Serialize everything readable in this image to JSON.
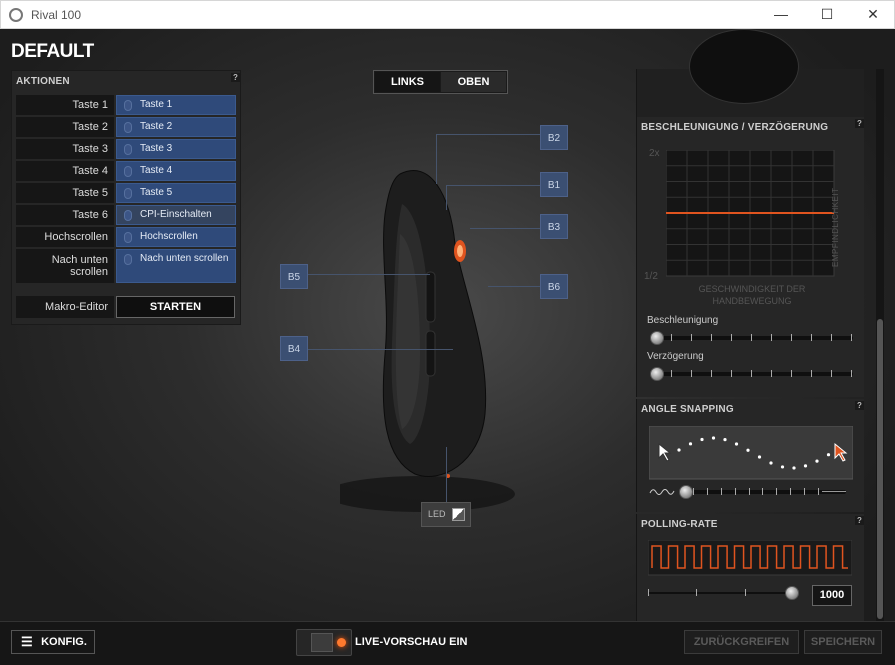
{
  "window": {
    "title": "Rival 100",
    "minimize": "—",
    "maximize": "☐",
    "close": "✕"
  },
  "profile": {
    "name": "DEFAULT"
  },
  "actions": {
    "title": "AKTIONEN",
    "help": "?",
    "rows": [
      {
        "label": "Taste 1",
        "value": "Taste 1"
      },
      {
        "label": "Taste 2",
        "value": "Taste 2"
      },
      {
        "label": "Taste 3",
        "value": "Taste 3"
      },
      {
        "label": "Taste 4",
        "value": "Taste 4"
      },
      {
        "label": "Taste 5",
        "value": "Taste 5"
      },
      {
        "label": "Taste 6",
        "value": "CPI-Einschalten"
      },
      {
        "label": "Hochscrollen",
        "value": "Hochscrollen"
      },
      {
        "label": "Nach unten scrollen",
        "value": "Nach unten scrollen"
      }
    ],
    "macro_label": "Makro-Editor",
    "macro_button": "STARTEN"
  },
  "view_toggle": {
    "left": "LINKS",
    "top": "OBEN",
    "selected": "LINKS"
  },
  "mouse_buttons": {
    "b1": "B1",
    "b2": "B2",
    "b3": "B3",
    "b4": "B4",
    "b5": "B5",
    "b6": "B6"
  },
  "led": {
    "label": "LED"
  },
  "acceleration": {
    "title": "BESCHLEUNIGUNG / VERZÖGERUNG",
    "help": "?",
    "y_top": "2x",
    "y_bottom": "1/2",
    "y_axis_label": "EMPFINDLICHKEIT",
    "x_axis_label_1": "GESCHWINDIGKEIT DER",
    "x_axis_label_2": "HANDBEWEGUNG",
    "accel_label": "Beschleunigung",
    "decel_label": "Verzögerung",
    "accel_value": 0,
    "decel_value": 0,
    "line_color": "#e0541f"
  },
  "angle_snapping": {
    "title": "ANGLE SNAPPING",
    "help": "?",
    "value": 0.05
  },
  "polling": {
    "title": "POLLING-RATE",
    "help": "?",
    "value": "1000",
    "wave_color": "#e0541f"
  },
  "footer": {
    "config_button": "KONFIG.",
    "live_preview": "LIVE-VORSCHAU EIN",
    "revert_button": "ZURÜCKGREIFEN",
    "save_button": "SPEICHERN"
  }
}
